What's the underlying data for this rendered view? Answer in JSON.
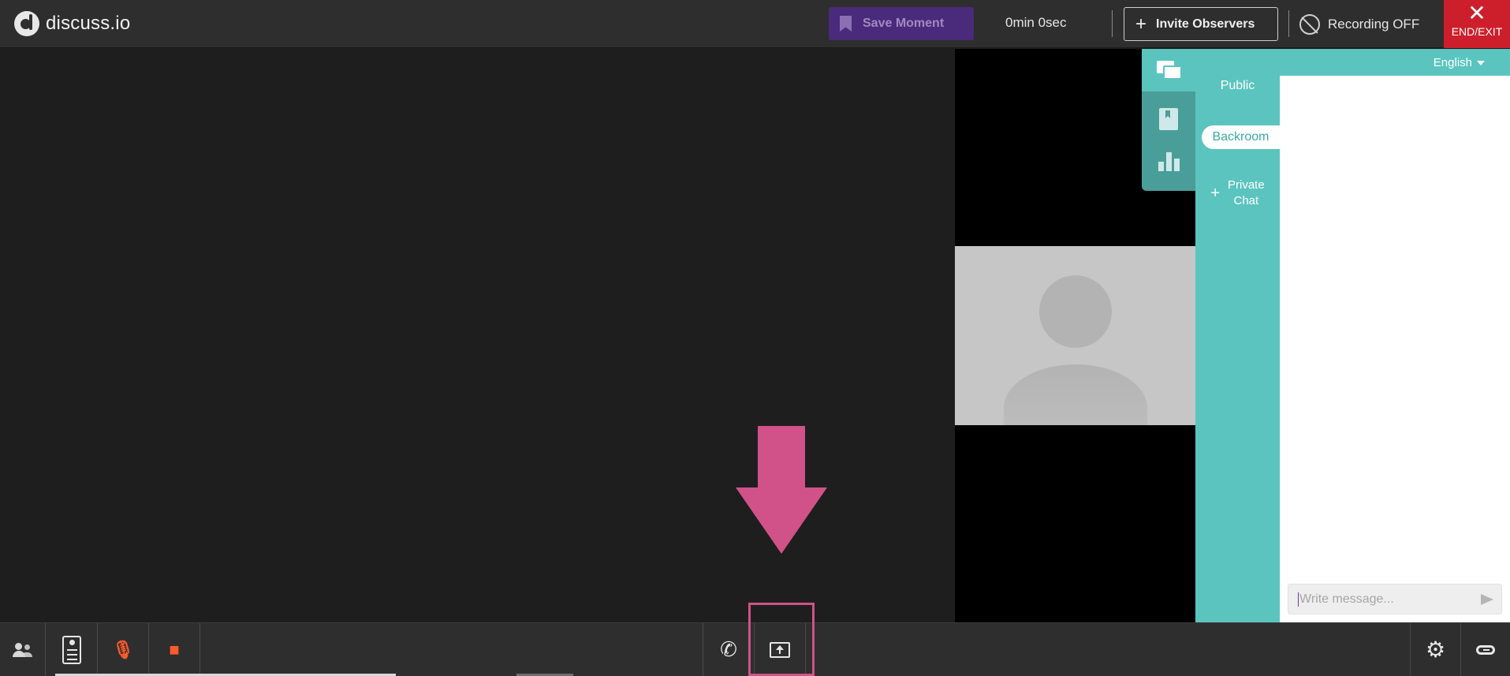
{
  "app": {
    "logo_text": "discuss.io"
  },
  "topbar": {
    "save_moment_label": "Save Moment",
    "timer": "0min 0sec",
    "invite_label": "Invite Observers",
    "recording_label": "Recording OFF",
    "end_label": "END/EXIT"
  },
  "chat": {
    "language": "English",
    "rooms": [
      "Public",
      "Backroom"
    ],
    "private_chat_label_line1": "Private",
    "private_chat_label_line2": "Chat",
    "input_placeholder": "Write message...",
    "active_room": "Backroom"
  },
  "side_tabs": [
    {
      "name": "chat",
      "icon": "chat-icon",
      "active": true
    },
    {
      "name": "notes",
      "icon": "book-icon",
      "active": false
    },
    {
      "name": "stats",
      "icon": "bar-chart-icon",
      "active": false
    }
  ],
  "bottombar": {
    "left_buttons": [
      "participants-icon",
      "attendee-list-icon",
      "mic-off-icon",
      "camera-off-icon"
    ],
    "center_buttons": [
      "phone-icon",
      "screen-share-icon"
    ],
    "right_buttons": [
      "settings-icon",
      "link-icon"
    ]
  },
  "colors": {
    "accent_teal": "#5bc4bf",
    "end_red": "#cc1f2b",
    "save_purple": "#4a2a7a",
    "muted_orange": "#ff5a2a",
    "annotation_pink": "#d05288"
  }
}
